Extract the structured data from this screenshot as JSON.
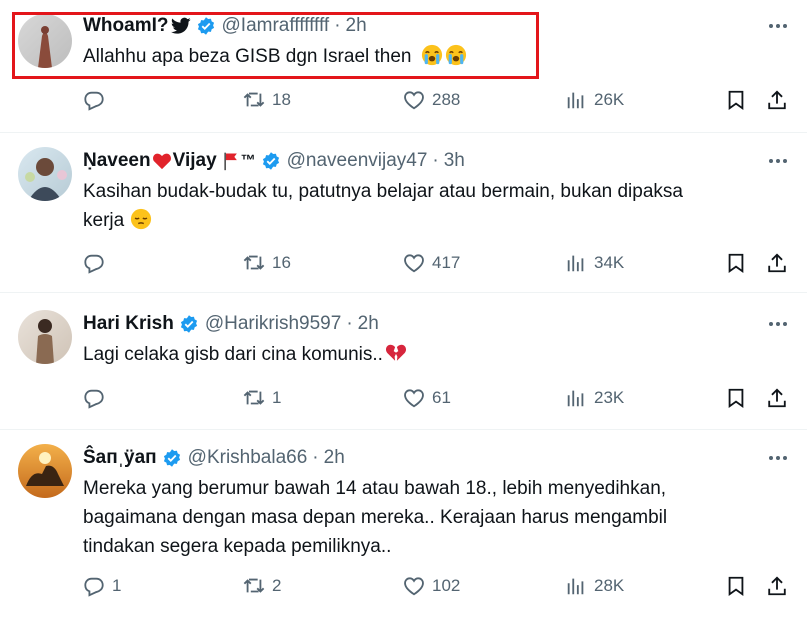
{
  "tweets": [
    {
      "name": "WhoamI?",
      "handle": "@Iamraffffffff",
      "dot": "·",
      "time": "2h",
      "lines": [
        "Allahhu apa beza GISB dgn Israel then"
      ],
      "emoji": [
        "crying-face",
        "crying-face"
      ],
      "reply": "",
      "retweet": "18",
      "like": "288",
      "views": "26K",
      "highlighted": true
    },
    {
      "name": "Ṇaveen",
      "name_suffix": "Vijay",
      "name_tail": "™",
      "handle": "@naveenvijay47",
      "dot": "·",
      "time": "3h",
      "lines": [
        "Kasihan budak-budak tu, patutnya belajar atau bermain, bukan dipaksa",
        "kerja"
      ],
      "emoji": [
        "pensive-face"
      ],
      "reply": "",
      "retweet": "16",
      "like": "417",
      "views": "34K"
    },
    {
      "name": "Hari Krish",
      "handle": "@Harikrish9597",
      "dot": "·",
      "time": "2h",
      "lines": [
        "Lagi celaka gisb dari cina komunis.."
      ],
      "emoji": [
        "broken-heart"
      ],
      "reply": "",
      "retweet": "1",
      "like": "61",
      "views": "23K"
    },
    {
      "name": "Ŝaпˌÿaп",
      "handle": "@Krishbala66",
      "dot": "·",
      "time": "2h",
      "lines": [
        "Mereka yang berumur bawah 14 atau bawah 18., lebih menyedihkan,",
        "bagaimana dengan masa depan mereka.. Kerajaan harus mengambil",
        "tindakan segera kepada pemiliknya.."
      ],
      "emoji": [],
      "reply": "1",
      "retweet": "2",
      "like": "102",
      "views": "28K"
    }
  ],
  "colors": {
    "verified": "#1d9bf0",
    "muted": "#536471",
    "text": "#0f1419",
    "highlight": "#e3151a"
  },
  "icons": [
    "reply-icon",
    "retweet-icon",
    "like-icon",
    "views-icon",
    "bookmark-icon",
    "share-icon",
    "more-icon",
    "verified-icon",
    "twitter-bird-icon"
  ]
}
